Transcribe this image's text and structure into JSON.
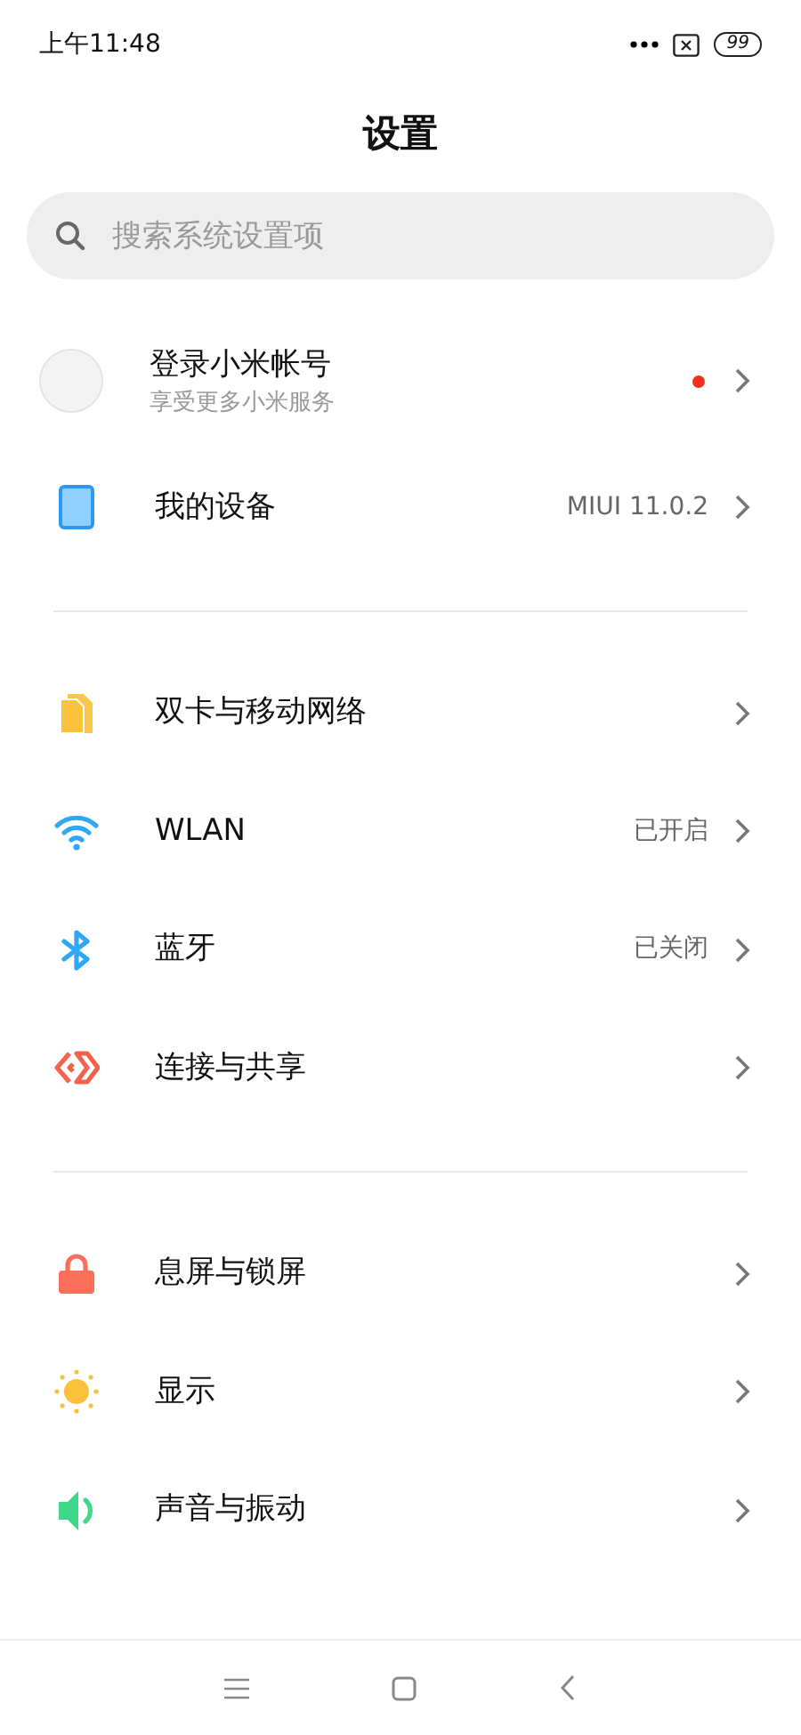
{
  "status_bar": {
    "time": "上午11:48",
    "battery": "99"
  },
  "title": "设置",
  "search": {
    "placeholder": "搜索系统设置项"
  },
  "account": {
    "name": "登录小米帐号",
    "subtitle": "享受更多小米服务",
    "notification_dot": true
  },
  "sections": [
    {
      "items": [
        {
          "label": "我的设备",
          "value": "MIUI 11.0.2"
        }
      ]
    },
    {
      "items": [
        {
          "label": "双卡与移动网络"
        },
        {
          "label": "WLAN",
          "value": "已开启"
        },
        {
          "label": "蓝牙",
          "value": "已关闭"
        },
        {
          "label": "连接与共享"
        }
      ]
    },
    {
      "items": [
        {
          "label": "息屏与锁屏"
        },
        {
          "label": "显示"
        },
        {
          "label": "声音与振动"
        }
      ]
    }
  ]
}
